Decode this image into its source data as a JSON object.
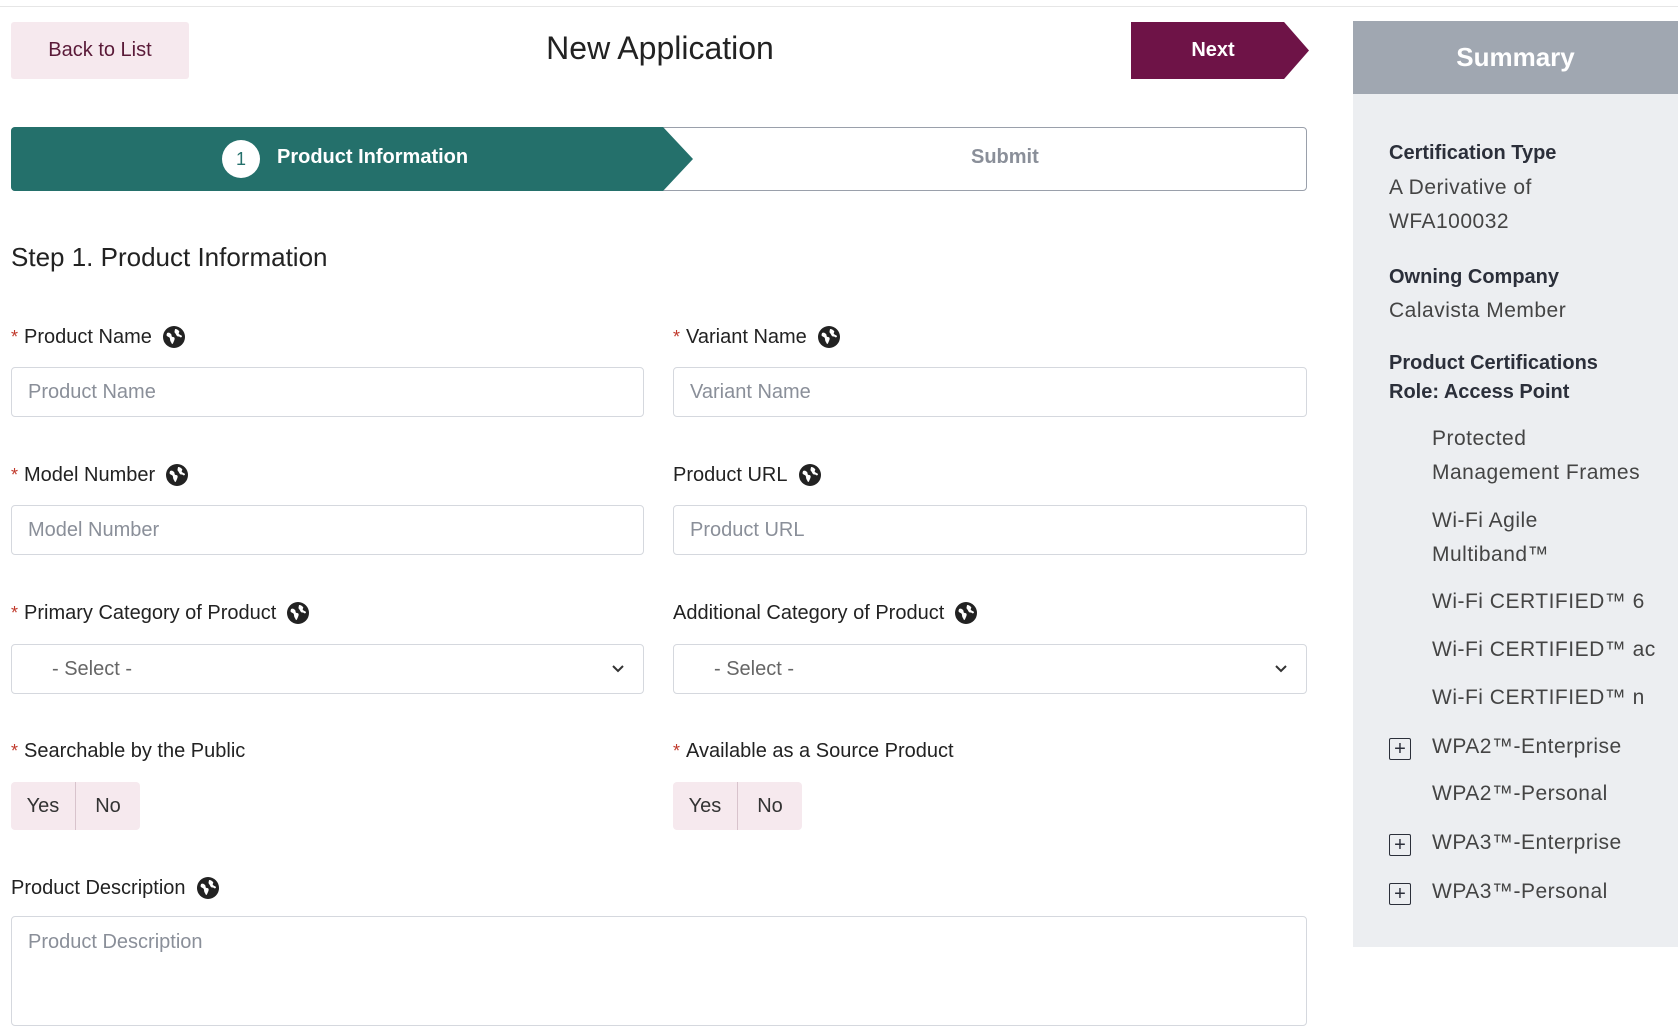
{
  "header": {
    "back_label": "Back to List",
    "title": "New Application",
    "next_label": "Next"
  },
  "stepper": {
    "steps": [
      {
        "number": "1",
        "label": "Product Information",
        "active": true
      },
      {
        "label": "Submit",
        "active": false
      }
    ]
  },
  "form": {
    "section_title": "Step 1. Product Information",
    "required_marker": "*",
    "fields": {
      "product_name": {
        "label": "Product Name",
        "placeholder": "Product Name",
        "value": ""
      },
      "variant_name": {
        "label": "Variant Name",
        "placeholder": "Variant Name",
        "value": ""
      },
      "model_number": {
        "label": "Model Number",
        "placeholder": "Model Number",
        "value": ""
      },
      "product_url": {
        "label": "Product URL",
        "placeholder": "Product URL",
        "value": ""
      },
      "primary_category": {
        "label": "Primary Category of Product",
        "selected": "- Select -"
      },
      "additional_category": {
        "label": "Additional Category of Product",
        "selected": "- Select -"
      },
      "searchable": {
        "label": "Searchable by the Public",
        "yes": "Yes",
        "no": "No"
      },
      "source_product": {
        "label": "Available as a Source Product",
        "yes": "Yes",
        "no": "No"
      },
      "description": {
        "label": "Product Description",
        "placeholder": "Product Description",
        "value": ""
      }
    }
  },
  "summary": {
    "title": "Summary",
    "certification_type_label": "Certification Type",
    "certification_type_value_lines": [
      "A Derivative of",
      "WFA100032"
    ],
    "owning_company_label": "Owning Company",
    "owning_company_value": "Calavista Member",
    "product_certifications_label": "Product Certifications",
    "role_label": "Role: Access Point",
    "certifications": [
      {
        "label_lines": [
          "Protected",
          "Management Frames"
        ],
        "expandable": false
      },
      {
        "label_lines": [
          "Wi-Fi Agile",
          "Multiband™"
        ],
        "expandable": false
      },
      {
        "label_lines": [
          "Wi-Fi CERTIFIED™ 6"
        ],
        "expandable": false
      },
      {
        "label_lines": [
          "Wi-Fi CERTIFIED™ ac"
        ],
        "expandable": false
      },
      {
        "label_lines": [
          "Wi-Fi CERTIFIED™ n"
        ],
        "expandable": false
      },
      {
        "label_lines": [
          "WPA2™-Enterprise"
        ],
        "expandable": true
      },
      {
        "label_lines": [
          "WPA2™-Personal"
        ],
        "expandable": false
      },
      {
        "label_lines": [
          "WPA3™-Enterprise"
        ],
        "expandable": true
      },
      {
        "label_lines": [
          "WPA3™-Personal"
        ],
        "expandable": true
      }
    ],
    "expand_symbol": "+"
  },
  "colors": {
    "brand": "#6e1347",
    "step_active": "#24706b",
    "required": "#c0392b"
  },
  "icons": {
    "field_help": "globe-icon",
    "dropdown": "chevron-down-icon",
    "expand": "plus-square-icon"
  }
}
